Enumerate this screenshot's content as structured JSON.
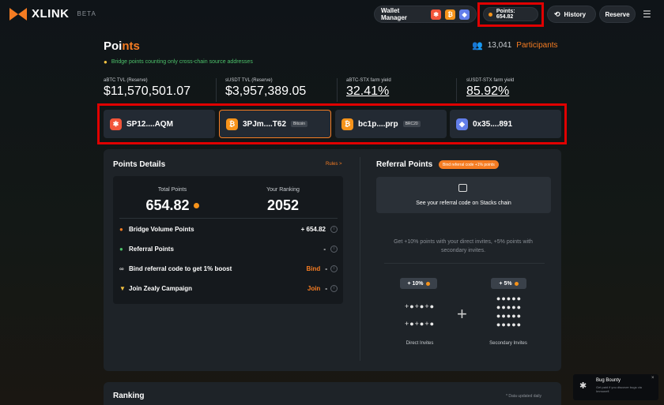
{
  "nav": {
    "brand": "XLINK",
    "beta": "BETA",
    "wallet_manager": "Wallet Manager",
    "points": "Points: 654.82",
    "history": "History",
    "reserve": "Reserve",
    "icons": [
      "stacks-icon",
      "bitcoin-icon",
      "ethereum-icon"
    ]
  },
  "header": {
    "title_main": "Poi",
    "title_accent": "nts",
    "participants_count": "13,041",
    "participants_label": "Participants",
    "notice": "Bridge points counting only cross-chain source addresses"
  },
  "stats": [
    {
      "label": "aBTC TVL (Reserve)",
      "value": "$11,570,501.07"
    },
    {
      "label": "sUSDT TVL (Reserve)",
      "value": "$3,957,389.05"
    },
    {
      "label": "aBTC-STX farm yield",
      "value": "32.41%"
    },
    {
      "label": "sUSDT-STX farm yield",
      "value": "85.92%"
    }
  ],
  "addresses": [
    {
      "address": "SP12....AQM",
      "icon": "stacks-icon",
      "tag": ""
    },
    {
      "address": "3PJm....T62",
      "icon": "bitcoin-icon",
      "tag": "Bitcoin"
    },
    {
      "address": "bc1p....prp",
      "icon": "bitcoin-icon",
      "tag": "BRC20"
    },
    {
      "address": "0x35....891",
      "icon": "ethereum-icon",
      "tag": ""
    }
  ],
  "points_details": {
    "heading": "Points Details",
    "rules": "Rules >",
    "total_label": "Total Points",
    "total_value": "654.82",
    "ranking_label": "Your Ranking",
    "ranking_value": "2052",
    "rows": [
      {
        "label": "Bridge Volume Points",
        "value": "+ 654.82"
      },
      {
        "label": "Referral Points",
        "value": "-"
      },
      {
        "label": "Bind referral code to get 1% boost",
        "action": "Bind",
        "value": "-"
      },
      {
        "label": "Join Zealy Campaign",
        "action": "Join",
        "value": "-"
      }
    ]
  },
  "referral": {
    "heading": "Referral Points",
    "badge": "Bind referral code +1% points",
    "card_text": "See your referral code on Stacks chain",
    "description": "Get +10% points with your direct invites, +5% points with secondary invites.",
    "direct_bonus": "+ 10%",
    "secondary_bonus": "+ 5%",
    "direct_caption": "Direct Invites",
    "secondary_caption": "Secondary Invites"
  },
  "ranking": {
    "heading": "Ranking",
    "note": "* Data updated daily"
  },
  "bug_bounty": {
    "title": "Bug Bounty",
    "subtitle": "Get paid if you discover bugs via Immunefi"
  }
}
